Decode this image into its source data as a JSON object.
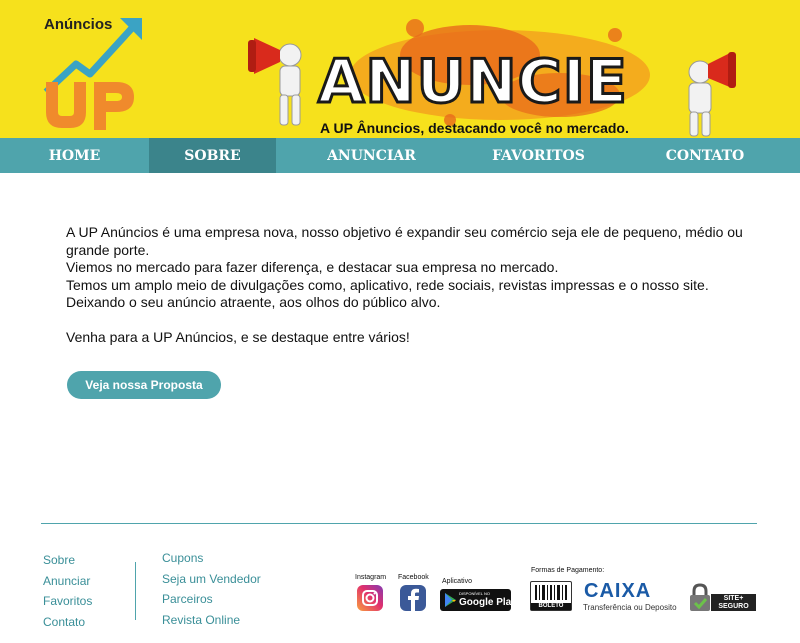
{
  "header": {
    "logo_text": "Anúncios",
    "banner_title": "ANUNCIE",
    "banner_subtitle": "A UP Ânuncios, destacando você no mercado."
  },
  "nav": {
    "items": [
      {
        "label": "HOME",
        "active": false
      },
      {
        "label": "SOBRE",
        "active": true
      },
      {
        "label": "ANUNCIAR",
        "active": false
      },
      {
        "label": "FAVORITOS",
        "active": false
      },
      {
        "label": "CONTATO",
        "active": false
      }
    ]
  },
  "main": {
    "paragraphs": [
      "A UP Anúncios é uma empresa nova, nosso objetivo é expandir seu comércio seja ele de pequeno, médio ou grande porte.",
      "Viemos no mercado para fazer diferença, e destacar sua empresa no mercado.",
      "Temos um amplo meio de divulgações como, aplicativo, rede sociais, revistas impressas e o nosso site.",
      "Deixando o seu anúncio atraente, aos olhos do público alvo."
    ],
    "closing": "Venha para a UP Anúncios, e se destaque entre vários!",
    "cta_label": "Veja nossa Proposta"
  },
  "footer": {
    "col1": [
      "Sobre",
      "Anunciar",
      "Favoritos",
      "Contato"
    ],
    "col2": [
      "Cupons",
      "Seja um Vendedor",
      "Parceiros",
      "Revista Online"
    ],
    "instagram_label": "Instagram",
    "facebook_label": "Facebook",
    "app_label": "Aplicativo",
    "google_play_small": "DISPONÍVEL NO",
    "google_play_big": "Google Play",
    "payment_title": "Formas de Pagamento:",
    "boleto_label": "BOLETO",
    "caixa_label": "CAIXA",
    "caixa_sub": "Transferência ou Deposito",
    "site_seguro_label": "SITE+ SEGURO"
  },
  "colors": {
    "header_bg": "#f6e11c",
    "nav_bg": "#4fa4ac",
    "nav_active": "#3b848b",
    "link": "#3a8f98",
    "logo_arrow": "#3ba3c4",
    "logo_up": "#f08a2c"
  }
}
